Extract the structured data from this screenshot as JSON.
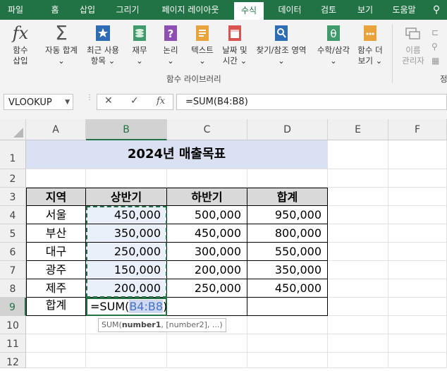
{
  "menu": {
    "tabs": [
      "파일",
      "홈",
      "삽입",
      "그리기",
      "페이지 레이아웃",
      "수식",
      "데이터",
      "검토",
      "보기",
      "도움말"
    ],
    "active_index": 5
  },
  "ribbon": {
    "buttons": [
      {
        "label1": "함수",
        "label2": "삽입"
      },
      {
        "label1": "자동 합계",
        "label2": "⌄"
      },
      {
        "label1": "최근 사용",
        "label2": "항목 ⌄"
      },
      {
        "label1": "재무",
        "label2": "⌄"
      },
      {
        "label1": "논리",
        "label2": "⌄"
      },
      {
        "label1": "텍스트",
        "label2": "⌄"
      },
      {
        "label1": "날짜 및",
        "label2": "시간 ⌄"
      },
      {
        "label1": "찾기/참조 영역",
        "label2": "⌄"
      },
      {
        "label1": "수학/삼각",
        "label2": "⌄"
      },
      {
        "label1": "함수 더",
        "label2": "보기 ⌄"
      },
      {
        "label1": "이름",
        "label2": "관리자"
      }
    ],
    "group_label": "함수 라이브러리",
    "group_label_partial": "정"
  },
  "formula_bar": {
    "name_box": "VLOOKUP",
    "fx_label": "fx",
    "formula": "=SUM(B4:B8)"
  },
  "sheet": {
    "columns": [
      "A",
      "B",
      "C",
      "D",
      "E",
      "F"
    ],
    "rows": [
      "1",
      "2",
      "3",
      "4",
      "5",
      "6",
      "7",
      "8",
      "9",
      "10",
      "11",
      "12"
    ],
    "title": "2024년 매출목표",
    "headers": [
      "지역",
      "상반기",
      "하반기",
      "합계"
    ],
    "data": [
      [
        "서울",
        "450,000",
        "500,000",
        "950,000"
      ],
      [
        "부산",
        "350,000",
        "450,000",
        "800,000"
      ],
      [
        "대구",
        "250,000",
        "300,000",
        "550,000"
      ],
      [
        "광주",
        "150,000",
        "200,000",
        "350,000"
      ],
      [
        "제주",
        "200,000",
        "250,000",
        "450,000"
      ]
    ],
    "total_label": "합계",
    "editing_prefix": "=SUM(",
    "editing_ref": "B4:B8",
    "editing_suffix": ")",
    "tooltip_fn": "SUM(",
    "tooltip_bold": "number1",
    "tooltip_rest": ", [number2], ...)"
  },
  "colors": {
    "accent": "#217346",
    "title_fill": "#D9E1F2",
    "header_fill": "#D9D9D9",
    "selection_fill": "#EAF0FA",
    "ref_text": "#4472C4"
  }
}
